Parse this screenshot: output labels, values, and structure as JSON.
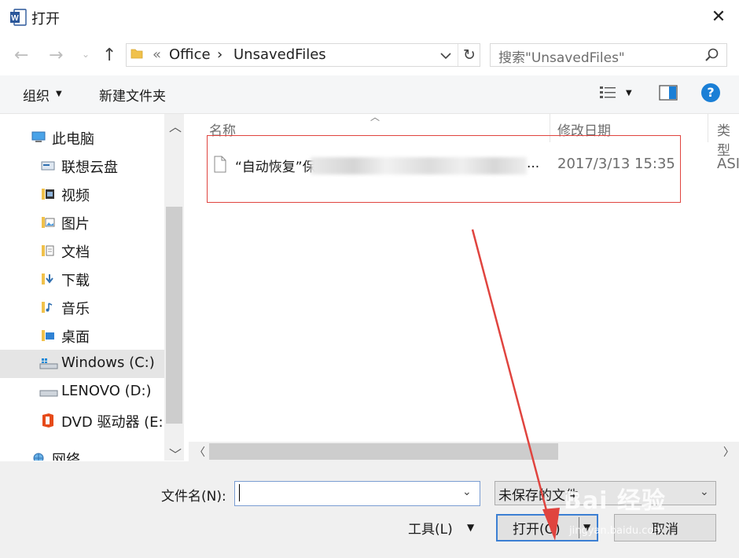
{
  "window": {
    "title": "打开",
    "close_glyph": "✕"
  },
  "address": {
    "breadcrumbs": [
      "«",
      "Office",
      "›",
      "UnsavedFiles"
    ],
    "search_placeholder": "搜索\"UnsavedFiles\""
  },
  "toolbar": {
    "organize_label": "组织",
    "new_folder_label": "新建文件夹",
    "help_label": "?"
  },
  "nav_pane": {
    "items": [
      {
        "label": "此电脑",
        "icon": "computer-icon"
      },
      {
        "label": "联想云盘",
        "icon": "cloud-drive-icon"
      },
      {
        "label": "视频",
        "icon": "video-folder-icon"
      },
      {
        "label": "图片",
        "icon": "pictures-folder-icon"
      },
      {
        "label": "文档",
        "icon": "documents-folder-icon"
      },
      {
        "label": "下载",
        "icon": "downloads-folder-icon"
      },
      {
        "label": "音乐",
        "icon": "music-folder-icon"
      },
      {
        "label": "桌面",
        "icon": "desktop-folder-icon"
      },
      {
        "label": "Windows (C:)",
        "icon": "drive-c-icon",
        "selected": true
      },
      {
        "label": "LENOVO (D:)",
        "icon": "drive-d-icon"
      },
      {
        "label": "DVD 驱动器 (E:)",
        "icon": "dvd-drive-icon"
      },
      {
        "label": "网络",
        "icon": "network-icon"
      }
    ]
  },
  "file_list": {
    "columns": [
      "名称",
      "修改日期",
      "类型"
    ],
    "files": [
      {
        "name": "“自动恢复”保",
        "ellipsis": "...",
        "modified": "2017/3/13 15:35",
        "type": "ASI"
      }
    ]
  },
  "bottom": {
    "filename_label": "文件名(N):",
    "filename_value": "",
    "filter_value": "未保存的文件",
    "tools_label": "工具(L)",
    "open_label": "打开(O)",
    "cancel_label": "取消"
  },
  "watermark": {
    "text": "Bai 经验",
    "sub": "jingyan.baidu.com"
  },
  "colors": {
    "accent": "#1a7fd6",
    "annotation": "#e0443f",
    "selection": "#e5e5e5"
  }
}
